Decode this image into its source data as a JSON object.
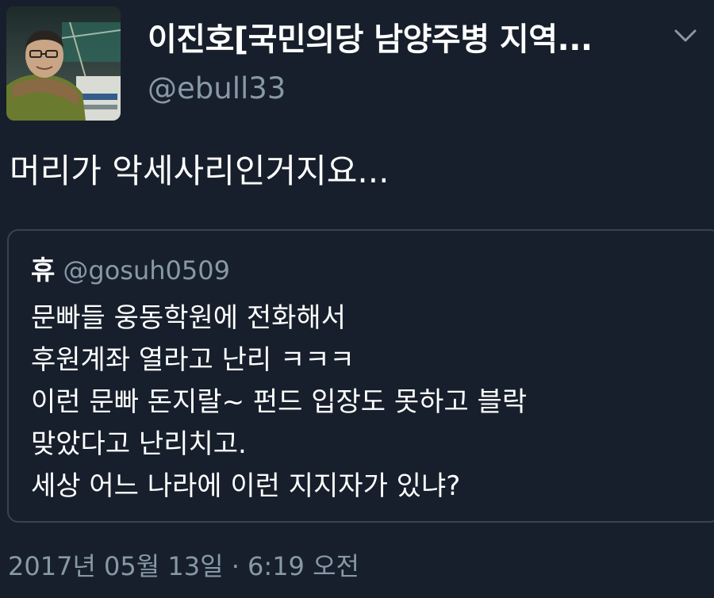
{
  "tweet": {
    "display_name": "이진호[국민의당 남양주병 지역...",
    "handle": "@ebull33",
    "text": "머리가 악세사리인거지요...",
    "avatar_icon": "profile-photo",
    "menu_icon": "chevron-down-icon",
    "timestamp": "2017년 05월 13일 · 6:19 오전"
  },
  "quote": {
    "name": "휴",
    "handle": "@gosuh0509",
    "lines": [
      "문빠들 웅동학원에 전화해서",
      "후원계좌 열라고 난리 ㅋㅋㅋ",
      "이런 문빠 돈지랄~ 펀드 입장도 못하고 블락",
      "맞았다고 난리치고.",
      "세상 어느 나라에 이런 지지자가 있냐?"
    ]
  },
  "colors": {
    "background": "#161f2b",
    "primary_text": "#ffffff",
    "secondary_text": "#8899a6",
    "quote_border": "#38444d"
  }
}
